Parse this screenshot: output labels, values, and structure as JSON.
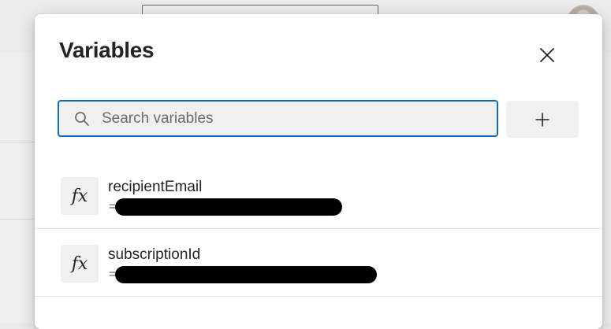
{
  "dialog": {
    "title": "Variables",
    "close_icon": "close-icon"
  },
  "search": {
    "placeholder": "Search variables",
    "icon": "search-icon",
    "value": ""
  },
  "add_button": {
    "icon": "plus-icon"
  },
  "variables": [
    {
      "icon": "fx-icon",
      "fx_glyph": "fx",
      "name": "recipientEmail",
      "value_prefix": "="
    },
    {
      "icon": "fx-icon",
      "fx_glyph": "fx",
      "name": "subscriptionId",
      "value_prefix": "="
    }
  ],
  "colors": {
    "accent": "#0f6cbd",
    "dialog_bg": "#ffffff",
    "input_bg": "#f0f0f0",
    "text": "#242424"
  }
}
